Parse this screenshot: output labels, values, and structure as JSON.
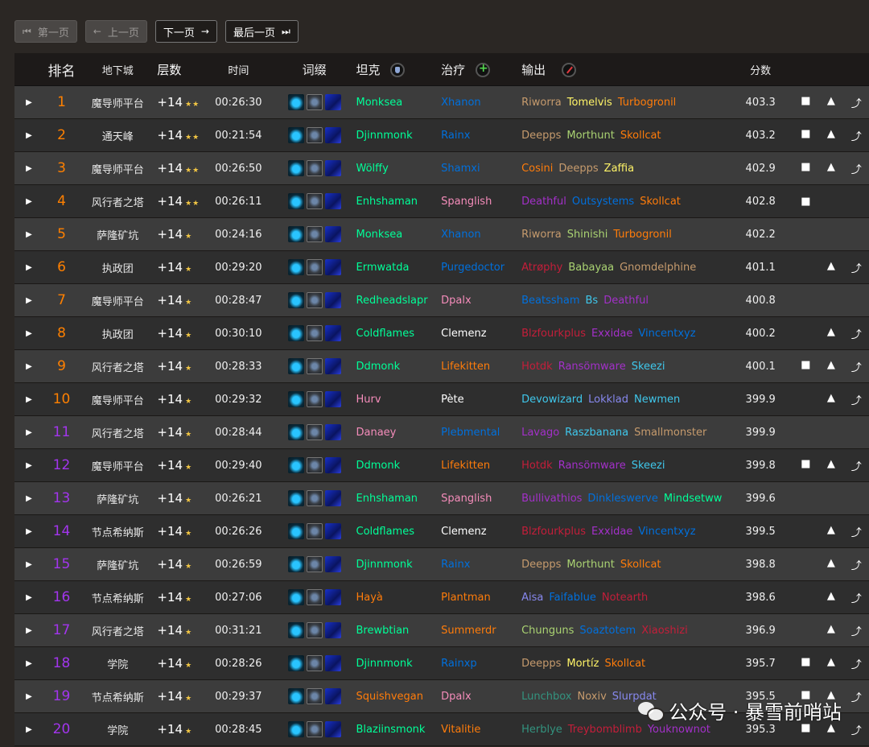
{
  "pager": {
    "first": "第一页",
    "prev": "上一页",
    "next": "下一页",
    "last": "最后一页"
  },
  "headers": {
    "rank": "排名",
    "dungeon": "地下城",
    "level": "层数",
    "time": "时间",
    "affixes": "词缀",
    "tank": "坦克",
    "healer": "治疗",
    "dps": "输出",
    "score": "分数"
  },
  "rows": [
    {
      "rank": "1",
      "rank_color": "#ff8000",
      "dungeon": "魔导师平台",
      "level": "+14",
      "stars": "★★",
      "time": "00:26:30",
      "tank": "Monksea",
      "tank_class": "monk",
      "healer": "Xhanon",
      "healer_class": "shaman",
      "dps": [
        {
          "name": "Riworra",
          "cls": "warrior"
        },
        {
          "name": "Tomelvis",
          "cls": "rogue"
        },
        {
          "name": "Turbogronil",
          "cls": "druid"
        }
      ],
      "score": "403.3",
      "links": [
        "video",
        "map",
        "route"
      ]
    },
    {
      "rank": "2",
      "rank_color": "#ff8000",
      "dungeon": "通天峰",
      "level": "+14",
      "stars": "★★",
      "time": "00:21:54",
      "tank": "Djinnmonk",
      "tank_class": "monk",
      "healer": "Rainx",
      "healer_class": "shaman",
      "dps": [
        {
          "name": "Deepps",
          "cls": "warrior"
        },
        {
          "name": "Morthunt",
          "cls": "hunter"
        },
        {
          "name": "Skollcat",
          "cls": "druid"
        }
      ],
      "score": "403.2",
      "links": [
        "video",
        "map",
        "route"
      ]
    },
    {
      "rank": "3",
      "rank_color": "#ff8000",
      "dungeon": "魔导师平台",
      "level": "+14",
      "stars": "★★",
      "time": "00:26:50",
      "tank": "Wölffy",
      "tank_class": "monk",
      "healer": "Shamxi",
      "healer_class": "shaman",
      "dps": [
        {
          "name": "Cosini",
          "cls": "druid"
        },
        {
          "name": "Deepps",
          "cls": "warrior"
        },
        {
          "name": "Zaffia",
          "cls": "rogue"
        }
      ],
      "score": "402.9",
      "links": [
        "video",
        "map",
        "route"
      ]
    },
    {
      "rank": "4",
      "rank_color": "#ff8000",
      "dungeon": "风行者之塔",
      "level": "+14",
      "stars": "★★",
      "time": "00:26:11",
      "tank": "Enhshaman",
      "tank_class": "monk",
      "healer": "Spanglish",
      "healer_class": "paladin",
      "dps": [
        {
          "name": "Deathful",
          "cls": "dh"
        },
        {
          "name": "Outsystems",
          "cls": "shaman"
        },
        {
          "name": "Skollcat",
          "cls": "druid"
        }
      ],
      "score": "402.8",
      "links": [
        "video"
      ]
    },
    {
      "rank": "5",
      "rank_color": "#ff8000",
      "dungeon": "萨隆矿坑",
      "level": "+14",
      "stars": "★",
      "time": "00:24:16",
      "tank": "Monksea",
      "tank_class": "monk",
      "healer": "Xhanon",
      "healer_class": "shaman",
      "dps": [
        {
          "name": "Riworra",
          "cls": "warrior"
        },
        {
          "name": "Shinishi",
          "cls": "hunter"
        },
        {
          "name": "Turbogronil",
          "cls": "druid"
        }
      ],
      "score": "402.2",
      "links": []
    },
    {
      "rank": "6",
      "rank_color": "#ff8000",
      "dungeon": "执政团",
      "level": "+14",
      "stars": "★",
      "time": "00:29:20",
      "tank": "Ermwatda",
      "tank_class": "monk",
      "healer": "Purgedoctor",
      "healer_class": "shaman",
      "dps": [
        {
          "name": "Atrøphy",
          "cls": "dk"
        },
        {
          "name": "Babayaa",
          "cls": "hunter"
        },
        {
          "name": "Gnomdelphine",
          "cls": "warrior"
        }
      ],
      "score": "401.1",
      "links": [
        "map",
        "route"
      ]
    },
    {
      "rank": "7",
      "rank_color": "#ff8000",
      "dungeon": "魔导师平台",
      "level": "+14",
      "stars": "★",
      "time": "00:28:47",
      "tank": "Redheadslapr",
      "tank_class": "monk",
      "healer": "Dpalx",
      "healer_class": "paladin",
      "dps": [
        {
          "name": "Beatssham",
          "cls": "shaman"
        },
        {
          "name": "Bs",
          "cls": "mage"
        },
        {
          "name": "Deathful",
          "cls": "dh"
        }
      ],
      "score": "400.8",
      "links": []
    },
    {
      "rank": "8",
      "rank_color": "#ff8000",
      "dungeon": "执政团",
      "level": "+14",
      "stars": "★",
      "time": "00:30:10",
      "tank": "Coldflames",
      "tank_class": "monk",
      "healer": "Clemenz",
      "healer_class": "priest",
      "dps": [
        {
          "name": "Blzfourkplus",
          "cls": "dk"
        },
        {
          "name": "Exxidae",
          "cls": "dh"
        },
        {
          "name": "Vincentxyz",
          "cls": "shaman"
        }
      ],
      "score": "400.2",
      "links": [
        "map",
        "route"
      ]
    },
    {
      "rank": "9",
      "rank_color": "#ff8000",
      "dungeon": "风行者之塔",
      "level": "+14",
      "stars": "★",
      "time": "00:28:33",
      "tank": "Ddmonk",
      "tank_class": "monk",
      "healer": "Lifekitten",
      "healer_class": "druid",
      "dps": [
        {
          "name": "Hotdk",
          "cls": "dk"
        },
        {
          "name": "Ransömware",
          "cls": "dh"
        },
        {
          "name": "Skeezi",
          "cls": "mage"
        }
      ],
      "score": "400.1",
      "links": [
        "video",
        "map",
        "route"
      ]
    },
    {
      "rank": "10",
      "rank_color": "#ff8000",
      "dungeon": "魔导师平台",
      "level": "+14",
      "stars": "★",
      "time": "00:29:32",
      "tank": "Hurv",
      "tank_class": "paladin",
      "healer": "Pète",
      "healer_class": "priest",
      "dps": [
        {
          "name": "Devowizard",
          "cls": "mage"
        },
        {
          "name": "Lokklad",
          "cls": "warlock"
        },
        {
          "name": "Newmen",
          "cls": "mage"
        }
      ],
      "score": "399.9",
      "links": [
        "map",
        "route"
      ]
    },
    {
      "rank": "11",
      "rank_color": "#a335ee",
      "dungeon": "风行者之塔",
      "level": "+14",
      "stars": "★",
      "time": "00:28:44",
      "tank": "Danaey",
      "tank_class": "paladin",
      "healer": "Plebmental",
      "healer_class": "shaman",
      "dps": [
        {
          "name": "Lavago",
          "cls": "dh"
        },
        {
          "name": "Raszbanana",
          "cls": "mage"
        },
        {
          "name": "Smallmonster",
          "cls": "warrior"
        }
      ],
      "score": "399.9",
      "links": []
    },
    {
      "rank": "12",
      "rank_color": "#a335ee",
      "dungeon": "魔导师平台",
      "level": "+14",
      "stars": "★",
      "time": "00:29:40",
      "tank": "Ddmonk",
      "tank_class": "monk",
      "healer": "Lifekitten",
      "healer_class": "druid",
      "dps": [
        {
          "name": "Hotdk",
          "cls": "dk"
        },
        {
          "name": "Ransömware",
          "cls": "dh"
        },
        {
          "name": "Skeezi",
          "cls": "mage"
        }
      ],
      "score": "399.8",
      "links": [
        "video",
        "map",
        "route"
      ]
    },
    {
      "rank": "13",
      "rank_color": "#a335ee",
      "dungeon": "萨隆矿坑",
      "level": "+14",
      "stars": "★",
      "time": "00:26:21",
      "tank": "Enhshaman",
      "tank_class": "monk",
      "healer": "Spanglish",
      "healer_class": "paladin",
      "dps": [
        {
          "name": "Bullivathios",
          "cls": "dh"
        },
        {
          "name": "Dinkleswerve",
          "cls": "shaman"
        },
        {
          "name": "Mindsetww",
          "cls": "monk"
        }
      ],
      "score": "399.6",
      "links": []
    },
    {
      "rank": "14",
      "rank_color": "#a335ee",
      "dungeon": "节点希纳斯",
      "level": "+14",
      "stars": "★",
      "time": "00:26:26",
      "tank": "Coldflames",
      "tank_class": "monk",
      "healer": "Clemenz",
      "healer_class": "priest",
      "dps": [
        {
          "name": "Blzfourkplus",
          "cls": "dk"
        },
        {
          "name": "Exxidae",
          "cls": "dh"
        },
        {
          "name": "Vincentxyz",
          "cls": "shaman"
        }
      ],
      "score": "399.5",
      "links": [
        "map",
        "route"
      ]
    },
    {
      "rank": "15",
      "rank_color": "#a335ee",
      "dungeon": "萨隆矿坑",
      "level": "+14",
      "stars": "★",
      "time": "00:26:59",
      "tank": "Djinnmonk",
      "tank_class": "monk",
      "healer": "Rainx",
      "healer_class": "shaman",
      "dps": [
        {
          "name": "Deepps",
          "cls": "warrior"
        },
        {
          "name": "Morthunt",
          "cls": "hunter"
        },
        {
          "name": "Skollcat",
          "cls": "druid"
        }
      ],
      "score": "398.8",
      "links": [
        "map",
        "route"
      ]
    },
    {
      "rank": "16",
      "rank_color": "#a335ee",
      "dungeon": "节点希纳斯",
      "level": "+14",
      "stars": "★",
      "time": "00:27:06",
      "tank": "Hayà",
      "tank_class": "druid",
      "healer": "Plantman",
      "healer_class": "druid",
      "dps": [
        {
          "name": "Aisa",
          "cls": "warlock"
        },
        {
          "name": "Faifablue",
          "cls": "shaman"
        },
        {
          "name": "Notearth",
          "cls": "dk"
        }
      ],
      "score": "398.6",
      "links": [
        "map",
        "route"
      ]
    },
    {
      "rank": "17",
      "rank_color": "#a335ee",
      "dungeon": "风行者之塔",
      "level": "+14",
      "stars": "★",
      "time": "00:31:21",
      "tank": "Brewbtian",
      "tank_class": "monk",
      "healer": "Summerdr",
      "healer_class": "druid",
      "dps": [
        {
          "name": "Chunguns",
          "cls": "hunter"
        },
        {
          "name": "Soaztotem",
          "cls": "shaman"
        },
        {
          "name": "Xiaoshizi",
          "cls": "dk"
        }
      ],
      "score": "396.9",
      "links": [
        "map",
        "route"
      ]
    },
    {
      "rank": "18",
      "rank_color": "#a335ee",
      "dungeon": "学院",
      "level": "+14",
      "stars": "★",
      "time": "00:28:26",
      "tank": "Djinnmonk",
      "tank_class": "monk",
      "healer": "Rainxp",
      "healer_class": "shaman",
      "dps": [
        {
          "name": "Deepps",
          "cls": "warrior"
        },
        {
          "name": "Mortíz",
          "cls": "rogue"
        },
        {
          "name": "Skollcat",
          "cls": "druid"
        }
      ],
      "score": "395.7",
      "links": [
        "video",
        "map",
        "route"
      ]
    },
    {
      "rank": "19",
      "rank_color": "#a335ee",
      "dungeon": "节点希纳斯",
      "level": "+14",
      "stars": "★",
      "time": "00:29:37",
      "tank": "Squishvegan",
      "tank_class": "druid",
      "healer": "Dpalx",
      "healer_class": "paladin",
      "dps": [
        {
          "name": "Lunchbox",
          "cls": "evoker"
        },
        {
          "name": "Noxiv",
          "cls": "warrior"
        },
        {
          "name": "Slurpdat",
          "cls": "warlock"
        }
      ],
      "score": "395.5",
      "links": [
        "video",
        "map",
        "route"
      ]
    },
    {
      "rank": "20",
      "rank_color": "#a335ee",
      "dungeon": "学院",
      "level": "+14",
      "stars": "★",
      "time": "00:28:45",
      "tank": "Blaziinsmonk",
      "tank_class": "monk",
      "healer": "Vitalitie",
      "healer_class": "druid",
      "dps": [
        {
          "name": "Herblye",
          "cls": "evoker"
        },
        {
          "name": "Treybomblimb",
          "cls": "dk"
        },
        {
          "name": "Youknownot",
          "cls": "dh"
        }
      ],
      "score": "395.3",
      "links": [
        "video",
        "map",
        "route"
      ]
    }
  ],
  "watermark": "公众号 · 暴雪前哨站"
}
